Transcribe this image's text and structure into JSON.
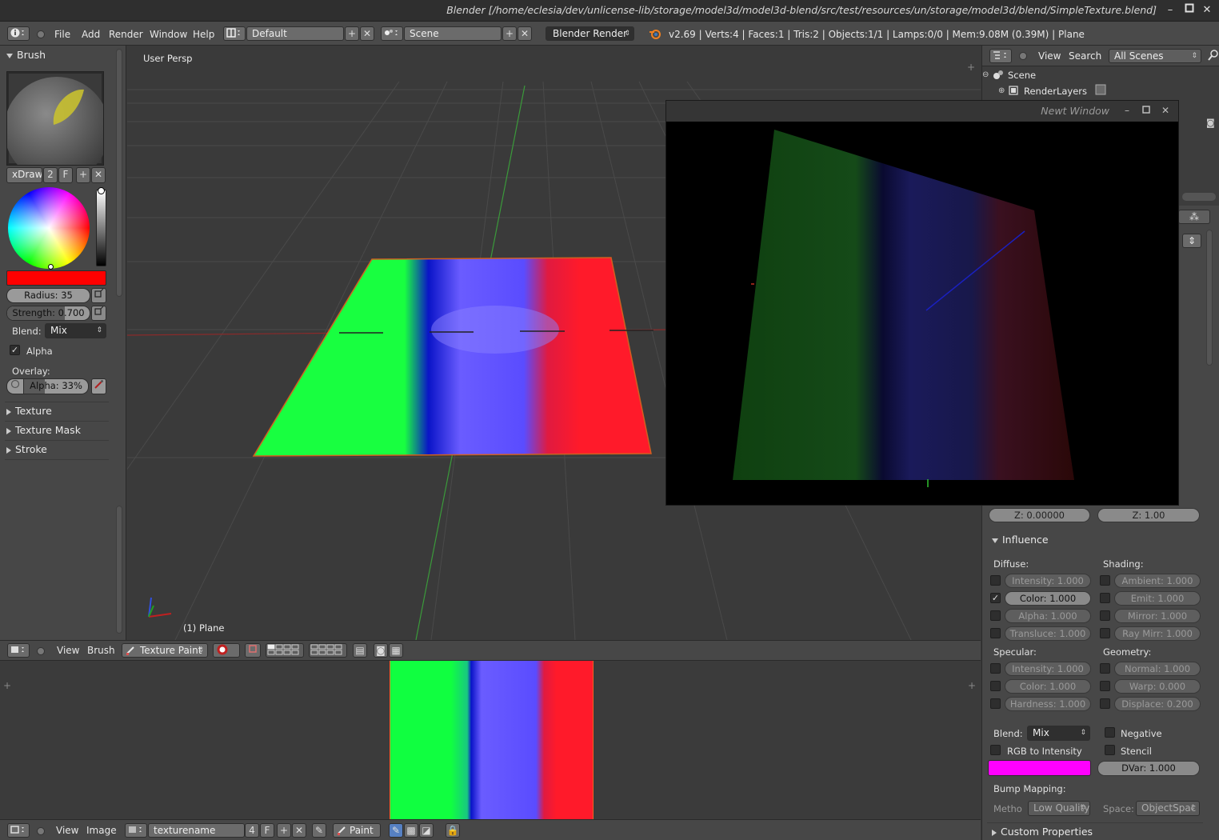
{
  "window": {
    "title": "Blender [/home/eclesia/dev/unlicense-lib/storage/model3d/model3d-blend/src/test/resources/un/storage/model3d/blend/SimpleTexture.blend]",
    "minimize_glyph": "–",
    "maximize_glyph": "▫",
    "close_glyph": "✕"
  },
  "info_header": {
    "menu": [
      "File",
      "Add",
      "Render",
      "Window",
      "Help"
    ],
    "screen_layout": "Default",
    "scene": "Scene",
    "render_engine": "Blender Render",
    "stats": "v2.69 | Verts:4 | Faces:1 | Tris:2 | Objects:1/1 | Lamps:0/0 | Mem:9.08M (0.39M) | Plane"
  },
  "tool_panel": {
    "brush_header": "Brush",
    "brush_name": "xDraw",
    "brush_users": "2",
    "fake_user": "F",
    "add_glyph": "+",
    "close_glyph": "✕",
    "color": "#ff0000",
    "radius_label": "Radius: 35",
    "strength_label": "Strength: 0.700",
    "strength_fraction": 0.7,
    "blend_label": "Blend:",
    "blend_value": "Mix",
    "alpha_checkbox_label": "Alpha",
    "overlay_label": "Overlay:",
    "overlay_alpha_label": "Alpha: 33%",
    "overlay_alpha_fraction": 0.33,
    "sections": [
      "Texture",
      "Texture Mask",
      "Stroke"
    ]
  },
  "viewport": {
    "view_label": "User Persp",
    "object_label": "(1) Plane"
  },
  "viewport_header": {
    "view": "View",
    "brush": "Brush",
    "mode": "Texture Paint"
  },
  "newt_window": {
    "title": "Newt Window"
  },
  "image_editor_header": {
    "view": "View",
    "image": "Image",
    "image_name": "texturename",
    "users": "4",
    "fake_user": "F",
    "paint_mode": "Paint"
  },
  "outliner": {
    "view": "View",
    "search": "Search",
    "filter": "All Scenes",
    "tree": [
      "Scene",
      "RenderLayers"
    ]
  },
  "properties": {
    "z_offset": "Z: 0.00000",
    "z_size": "Z: 1.00",
    "influence_header": "Influence",
    "diffuse_label": "Diffuse:",
    "shading_label": "Shading:",
    "diffuse": [
      {
        "label": "Intensity: 1.000",
        "checked": false
      },
      {
        "label": "Color: 1.000",
        "checked": true
      },
      {
        "label": "Alpha: 1.000",
        "checked": false
      },
      {
        "label": "Translucе: 1.000",
        "checked": false
      }
    ],
    "shading": [
      {
        "label": "Ambient: 1.000",
        "checked": false
      },
      {
        "label": "Emit: 1.000",
        "checked": false
      },
      {
        "label": "Mirror: 1.000",
        "checked": false
      },
      {
        "label": "Ray Mirr: 1.000",
        "checked": false
      }
    ],
    "specular_label": "Specular:",
    "geometry_label": "Geometry:",
    "specular": [
      {
        "label": "Intensity: 1.000",
        "checked": false
      },
      {
        "label": "Color: 1.000",
        "checked": false
      },
      {
        "label": "Hardness: 1.000",
        "checked": false
      }
    ],
    "geometry": [
      {
        "label": "Normal: 1.000",
        "checked": false
      },
      {
        "label": "Warp: 0.000",
        "checked": false
      },
      {
        "label": "Displace: 0.200",
        "checked": false
      }
    ],
    "blend_label": "Blend:",
    "blend_value": "Mix",
    "negative_label": "Negative",
    "rgb_to_intensity_label": "RGB to Intensity",
    "stencil_label": "Stencil",
    "texture_color": "#ff00ff",
    "dvar_label": "DVar: 1.000",
    "bump_header": "Bump Mapping:",
    "method_label": "Metho",
    "method_value": "Low Quality",
    "space_label": "Space:",
    "space_value": "ObjectSpac",
    "custom_props": "Custom Properties"
  }
}
